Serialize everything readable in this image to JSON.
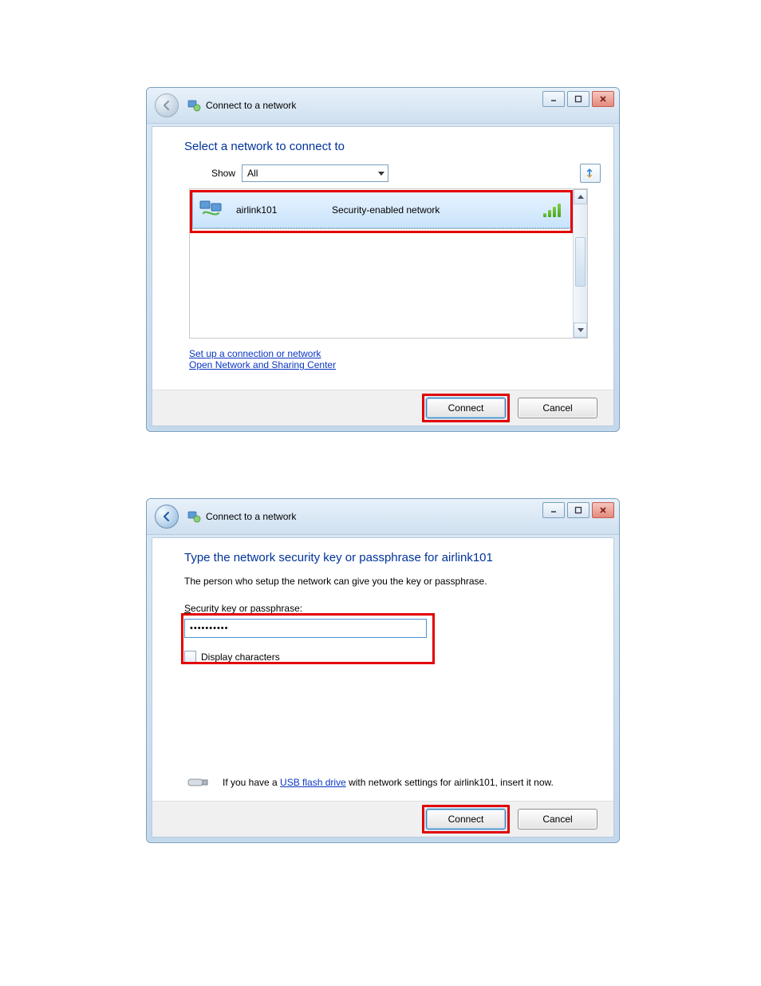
{
  "dialog1": {
    "title": "Connect to a network",
    "heading": "Select a network to connect to",
    "show_label": "Show",
    "show_value": "All",
    "network": {
      "name": "airlink101",
      "sec": "Security-enabled network"
    },
    "link_setup": "Set up a connection or network",
    "link_center": "Open Network and Sharing Center",
    "btn_connect": "Connect",
    "btn_cancel": "Cancel"
  },
  "dialog2": {
    "title": "Connect to a network",
    "heading": "Type the network security key or passphrase for airlink101",
    "subtext": "The person who setup the network can give you the key or passphrase.",
    "field_label_pre": "S",
    "field_label_rest": "ecurity key or passphrase:",
    "password_masked": "••••••••••",
    "display_pre": "D",
    "display_rest": "isplay characters",
    "usb_pre": "If you have a ",
    "usb_link": "USB flash drive",
    "usb_post": " with network settings for airlink101, insert it now.",
    "btn_connect": "Connect",
    "btn_cancel": "Cancel"
  }
}
